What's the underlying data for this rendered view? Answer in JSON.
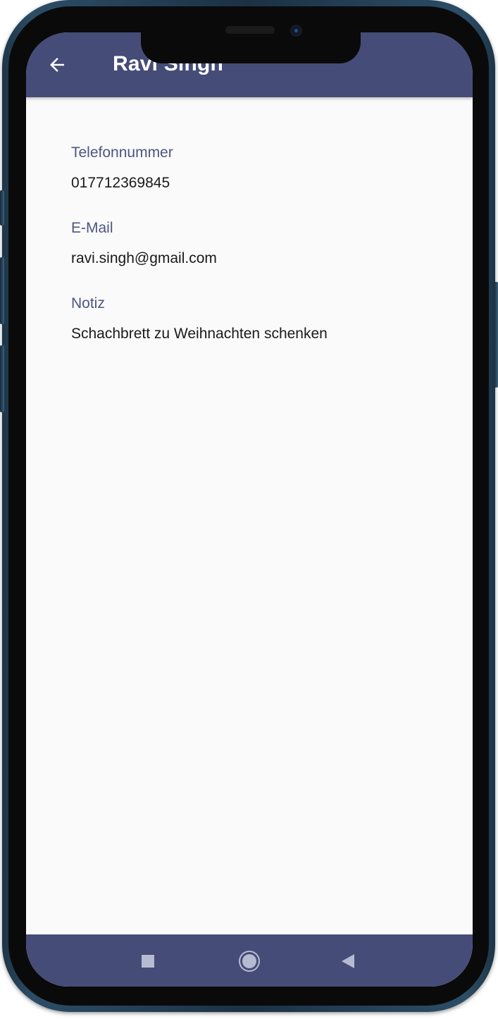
{
  "app_bar": {
    "title": "Ravi Singh",
    "back_icon": "arrow-left-icon",
    "background_color": "#454c77"
  },
  "contact": {
    "fields": [
      {
        "label": "Telefonnummer",
        "value": "017712369845"
      },
      {
        "label": "E-Mail",
        "value": "ravi.singh@gmail.com"
      },
      {
        "label": "Notiz",
        "value": "Schachbrett zu Weihnachten schenken"
      }
    ],
    "label_color": "#4e5583"
  },
  "nav_bar": {
    "icons": [
      "recents-square-icon",
      "home-circle-icon",
      "back-triangle-icon"
    ],
    "background_color": "#454c77"
  }
}
